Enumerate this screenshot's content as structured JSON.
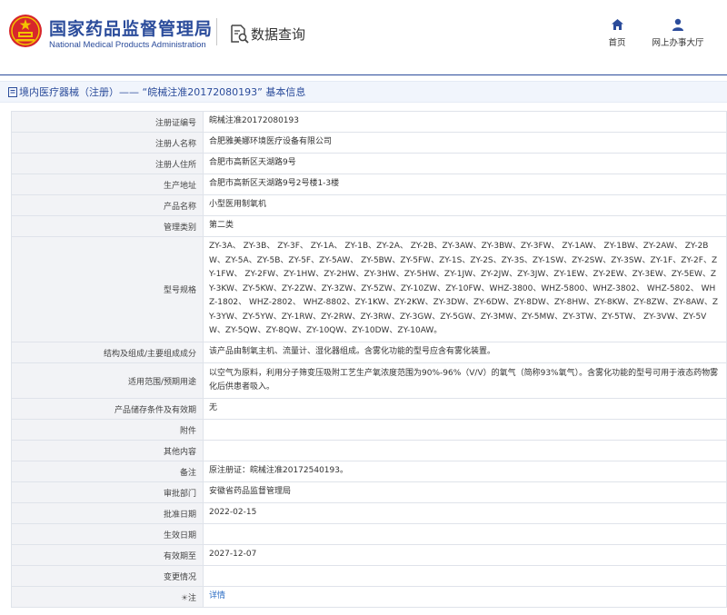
{
  "header": {
    "logo_cn": "国家药品监督管理局",
    "logo_en": "National Medical Products Administration",
    "query_label": "数据查询",
    "nav_home": "首页",
    "nav_hall": "网上办事大厅",
    "brand_color": "#2b4c9b"
  },
  "breadcrumb": {
    "text": "境内医疗器械（注册）—— “皖械注准20172080193” 基本信息"
  },
  "detail": {
    "reg_no": {
      "label": "注册证编号",
      "value": "皖械注准20172080193"
    },
    "registrant": {
      "label": "注册人名称",
      "value": "合肥雅美娜环境医疗设备有限公司"
    },
    "address": {
      "label": "注册人住所",
      "value": "合肥市高新区天湖路9号"
    },
    "production_address": {
      "label": "生产地址",
      "value": "合肥市高新区天湖路9号2号楼1-3楼"
    },
    "product_name": {
      "label": "产品名称",
      "value": "小型医用制氧机"
    },
    "category": {
      "label": "管理类别",
      "value": "第二类"
    },
    "models": {
      "label": "型号规格",
      "value": "ZY-3A、 ZY-3B、 ZY-3F、 ZY-1A、 ZY-1B、ZY-2A、 ZY-2B、ZY-3AW、ZY-3BW、ZY-3FW、 ZY-1AW、 ZY-1BW、ZY-2AW、 ZY-2BW、ZY-5A、ZY-5B、ZY-5F、ZY-5AW、 ZY-5BW、ZY-5FW、ZY-1S、ZY-2S、ZY-3S、ZY-1SW、ZY-2SW、ZY-3SW、ZY-1F、ZY-2F、ZY-1FW、 ZY-2FW、ZY-1HW、ZY-2HW、ZY-3HW、ZY-5HW、ZY-1JW、ZY-2JW、ZY-3JW、ZY-1EW、ZY-2EW、ZY-3EW、ZY-5EW、ZY-3KW、ZY-5KW、ZY-2ZW、ZY-3ZW、ZY-5ZW、ZY-10ZW、ZY-10FW、WHZ-3800、WHZ-5800、WHZ-3802、 WHZ-5802、 WHZ-1802、 WHZ-2802、 WHZ-8802、ZY-1KW、ZY-2KW、ZY-3DW、ZY-6DW、ZY-8DW、ZY-8HW、ZY-8KW、ZY-8ZW、ZY-8AW、ZY-3YW、ZY-5YW、ZY-1RW、ZY-2RW、ZY-3RW、ZY-3GW、ZY-5GW、ZY-3MW、ZY-5MW、ZY-3TW、ZY-5TW、 ZY-3VW、ZY-5VW、ZY-5QW、ZY-8QW、ZY-10QW、ZY-10DW、ZY-10AW。"
    },
    "structure": {
      "label": "结构及组成/主要组成成分",
      "value": "该产品由制氧主机、流量计、湿化器组成。含雾化功能的型号应含有雾化装置。"
    },
    "scope": {
      "label": "适用范围/预期用途",
      "value": "以空气为原料，利用分子筛变压吸附工艺生产氧浓度范围为90%-96%（V/V）的氧气（简称93%氧气）。含雾化功能的型号可用于液态药物雾化后供患者吸入。"
    },
    "storage": {
      "label": "产品储存条件及有效期",
      "value": "无"
    },
    "attachment": {
      "label": "附件",
      "value": ""
    },
    "other": {
      "label": "其他内容",
      "value": ""
    },
    "remarks": {
      "label": "备注",
      "value": "原注册证：皖械注准20172540193。"
    },
    "approval_dept": {
      "label": "审批部门",
      "value": "安徽省药品监督管理局"
    },
    "approval_date": {
      "label": "批准日期",
      "value": "2022-02-15"
    },
    "effective_date": {
      "label": "生效日期",
      "value": ""
    },
    "expiry_date": {
      "label": "有效期至",
      "value": "2027-12-07"
    },
    "changes": {
      "label": "变更情况",
      "value": ""
    },
    "note": {
      "label": "注",
      "value": "详情",
      "icon": "sun-icon"
    }
  }
}
